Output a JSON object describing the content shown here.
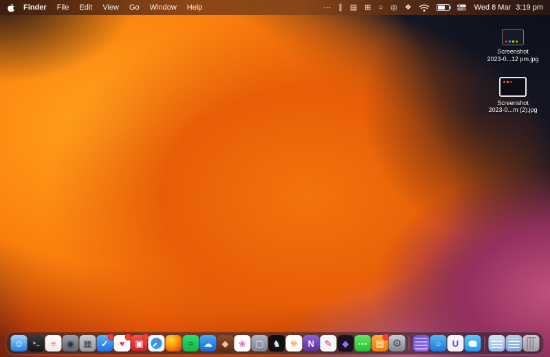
{
  "menubar": {
    "active_app": "Finder",
    "menus": [
      "File",
      "Edit",
      "View",
      "Go",
      "Window",
      "Help"
    ],
    "status_icons": [
      {
        "name": "more-status-icon",
        "glyph": "⋯"
      },
      {
        "name": "pause-icon",
        "glyph": "∥"
      },
      {
        "name": "stage-manager-icon",
        "glyph": "▤"
      },
      {
        "name": "display-icon",
        "glyph": "⊞"
      },
      {
        "name": "screen-record-icon",
        "glyph": "○"
      },
      {
        "name": "focus-icon",
        "glyph": "◎"
      },
      {
        "name": "shortcuts-icon",
        "glyph": "❖"
      }
    ],
    "clock_date": "Wed 8 Mar",
    "clock_time": "3:19 pm"
  },
  "desktop": {
    "files": [
      {
        "name": "desktop-file-screenshot-1",
        "label_line1": "Screenshot",
        "label_line2": "2023-0...12 pm.jpg"
      },
      {
        "name": "desktop-file-screenshot-2",
        "label_line1": "Screenshot",
        "label_line2": "2023-0...m (2).jpg"
      }
    ]
  },
  "dock": {
    "items": [
      {
        "id": "finder",
        "name": "finder-icon",
        "glyph": "☺"
      },
      {
        "id": "terminal",
        "name": "terminal-icon",
        "glyph": ">_"
      },
      {
        "id": "books",
        "name": "books-icon",
        "glyph": "≡"
      },
      {
        "id": "photo-booth",
        "name": "photo-booth-icon",
        "glyph": "◉"
      },
      {
        "id": "mission-control",
        "name": "mission-control-icon",
        "glyph": "▦"
      },
      {
        "id": "tasks",
        "name": "tasks-app-icon",
        "glyph": "✓",
        "badge": true
      },
      {
        "id": "music",
        "name": "music-icon",
        "glyph": "♥",
        "badge": true
      },
      {
        "id": "red-app",
        "name": "red-app-icon",
        "glyph": "▣",
        "badge": true
      },
      {
        "id": "safari",
        "name": "safari-icon",
        "glyph": ""
      },
      {
        "id": "firefox",
        "name": "firefox-icon",
        "glyph": ""
      },
      {
        "id": "spotify",
        "name": "spotify-icon",
        "glyph": "≈"
      },
      {
        "id": "cloud",
        "name": "cloud-app-icon",
        "glyph": "☁"
      },
      {
        "id": "maroon-app",
        "name": "maroon-app-icon",
        "glyph": "◆"
      },
      {
        "id": "butterfly",
        "name": "butterfly-app-icon",
        "glyph": "❀"
      },
      {
        "id": "window-app",
        "name": "window-app-icon",
        "glyph": "▢"
      },
      {
        "id": "figure-app",
        "name": "dark-figure-app-icon",
        "glyph": "♞"
      },
      {
        "id": "photos",
        "name": "photos-icon",
        "glyph": "❋"
      },
      {
        "id": "onenote",
        "name": "onenote-icon",
        "glyph": "N"
      },
      {
        "id": "notability",
        "name": "notability-icon",
        "glyph": "✎"
      },
      {
        "id": "obsidian",
        "name": "obsidian-icon",
        "glyph": "◆"
      },
      {
        "id": "messages",
        "name": "messages-icon",
        "glyph": "…"
      },
      {
        "id": "orange-app",
        "name": "orange-app-icon",
        "glyph": "▤",
        "badge": true
      },
      {
        "id": "settings",
        "name": "system-settings-icon",
        "glyph": "⚙"
      },
      {
        "type": "separator"
      },
      {
        "id": "minimized-window",
        "name": "minimized-window-thumbnail",
        "glyph": ""
      },
      {
        "id": "blue-app",
        "name": "blue-app-icon",
        "glyph": "○"
      },
      {
        "id": "u-app",
        "name": "u-app-icon",
        "glyph": "U"
      },
      {
        "id": "twitter",
        "name": "twitter-icon",
        "glyph": ""
      },
      {
        "type": "separator"
      },
      {
        "id": "downloads",
        "name": "downloads-folder-icon",
        "glyph": ""
      },
      {
        "id": "documents",
        "name": "documents-folder-icon",
        "glyph": ""
      },
      {
        "id": "trash",
        "name": "trash-icon",
        "glyph": ""
      }
    ]
  },
  "colors": {
    "badge_red": "#ff3b30",
    "menubar_tint": "#7c431c",
    "dock_bg": "rgba(44,36,48,0.55)",
    "wallpaper_orange": "#fb7e0d",
    "wallpaper_magenta": "#b5487e",
    "wallpaper_dark": "#131a28"
  }
}
